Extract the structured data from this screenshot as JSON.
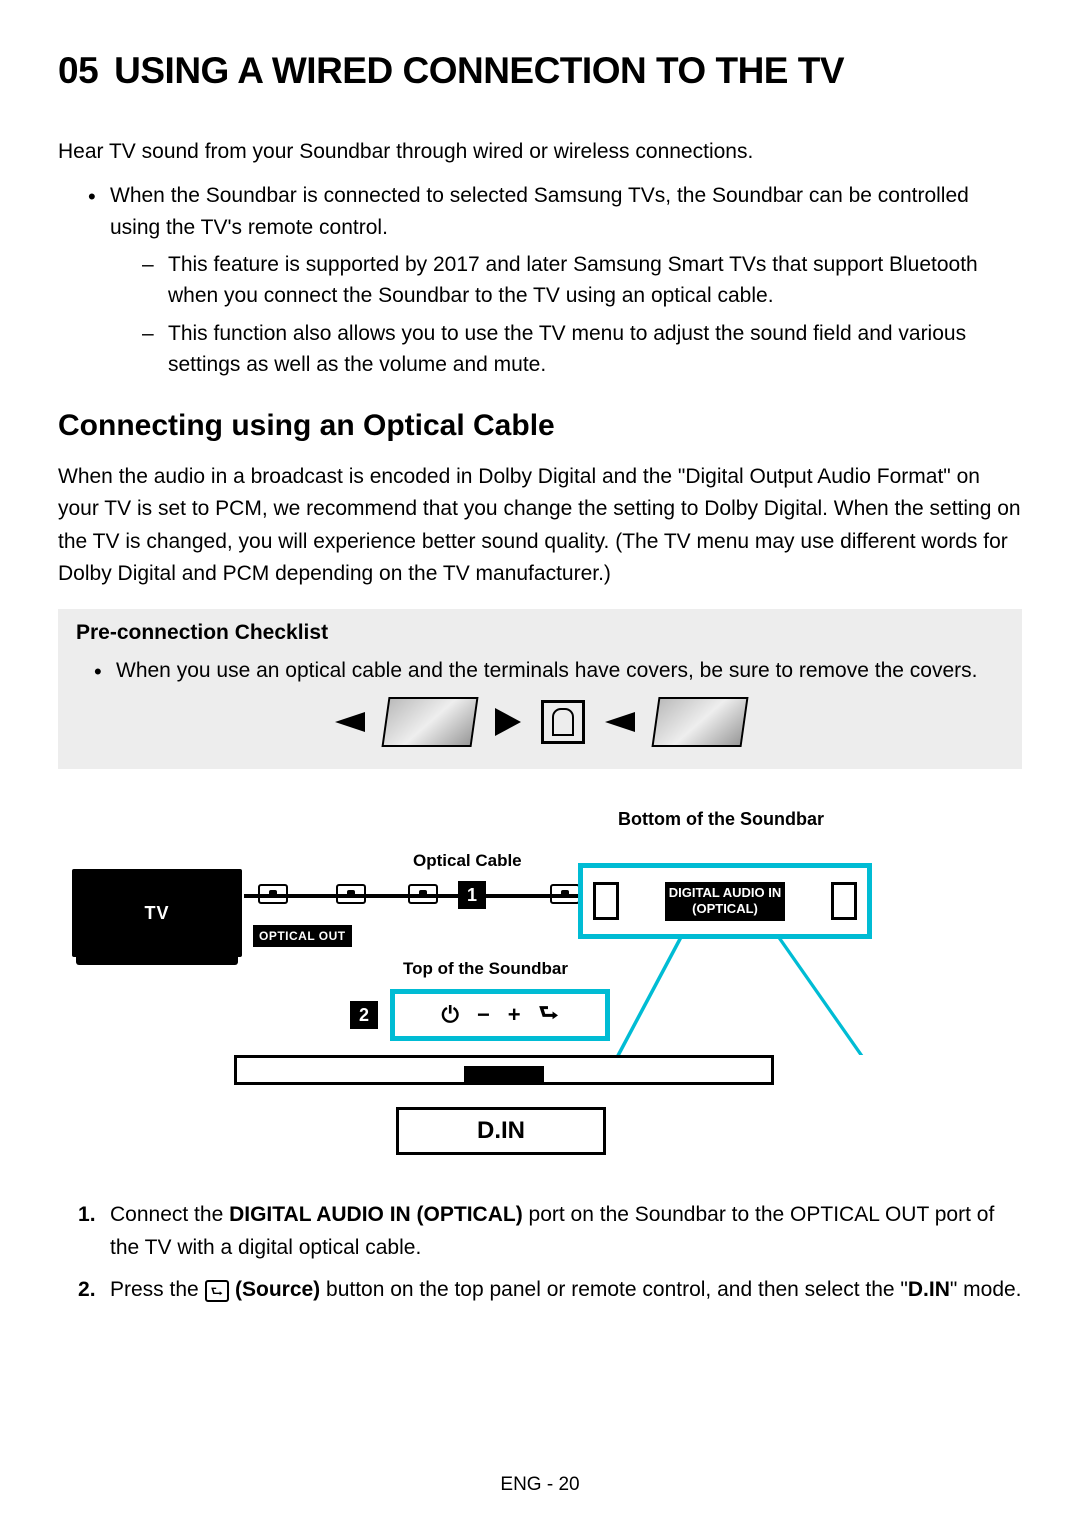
{
  "section_number": "05",
  "section_title": "USING A WIRED CONNECTION TO THE TV",
  "intro": "Hear TV sound from your Soundbar through wired or wireless connections.",
  "bullet_main": "When the Soundbar is connected to selected Samsung TVs, the Soundbar can be controlled using the TV's remote control.",
  "dash1": "This feature is supported by 2017 and later Samsung Smart TVs that support Bluetooth when you connect the Soundbar to the TV using an optical cable.",
  "dash2": "This function also allows you to use the TV menu to adjust the sound field and various settings as well as the volume and mute.",
  "subheading": "Connecting using an Optical Cable",
  "body_para": "When the audio in a broadcast is encoded in Dolby Digital and the \"Digital Output Audio Format\" on your TV is set to PCM, we recommend that you change the setting to Dolby Digital. When the setting on the TV is changed, you will experience better sound quality. (The TV menu may use different words for Dolby Digital and PCM depending on the TV manufacturer.)",
  "checklist_title": "Pre-connection Checklist",
  "checklist_item": "When you use an optical cable and the terminals have covers, be sure to remove the covers.",
  "labels": {
    "bottom_sb": "Bottom of the Soundbar",
    "optical_cable": "Optical Cable",
    "top_sb": "Top of the Soundbar",
    "tv": "TV",
    "optical_out": "OPTICAL OUT",
    "digital_in_l1": "DIGITAL AUDIO IN",
    "digital_in_l2": "(OPTICAL)",
    "din": "D.IN",
    "step1": "1",
    "step2": "2"
  },
  "steps": {
    "s1_pre": "Connect the ",
    "s1_bold": "DIGITAL AUDIO IN (OPTICAL)",
    "s1_post": " port on the Soundbar to the OPTICAL OUT port of the TV with a digital optical cable.",
    "s2_pre": "Press the ",
    "s2_bold": "(Source)",
    "s2_mid": " button on the top panel or remote control, and then select the \"",
    "s2_bold2": "D.IN",
    "s2_post": "\" mode."
  },
  "footer": "ENG - 20"
}
